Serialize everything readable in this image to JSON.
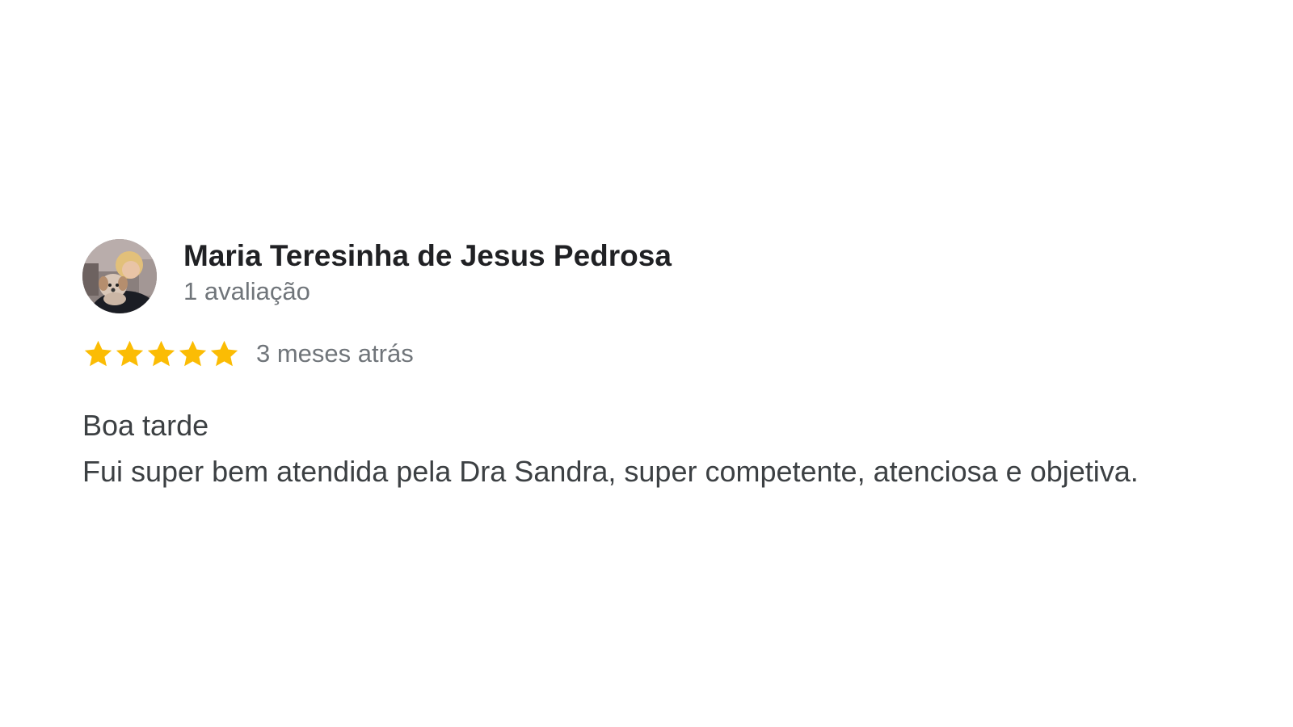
{
  "review": {
    "author": {
      "name": "Maria Teresinha de Jesus Pedrosa",
      "meta": "1 avaliação",
      "avatar_icon": "profile-photo"
    },
    "rating": {
      "value": 5,
      "max": 5,
      "star_color": "#fbbc04",
      "star_icon": "star-icon"
    },
    "time": "3 meses atrás",
    "text_lines": [
      "Boa tarde",
      "Fui super bem atendida pela Dra Sandra, super competente, atenciosa e objetiva."
    ]
  },
  "colors": {
    "name": "#202124",
    "meta": "#70757a",
    "body": "#3c4043",
    "background": "#ffffff"
  }
}
